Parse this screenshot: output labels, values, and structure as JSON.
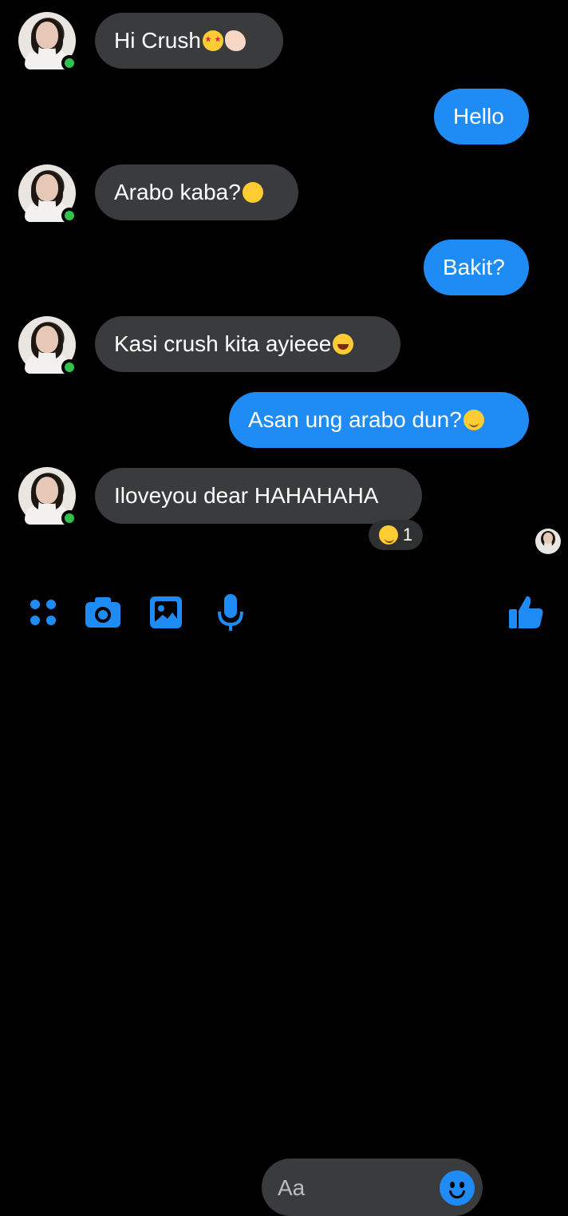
{
  "messages": [
    {
      "id": "m1",
      "side": "incoming",
      "text": "Hi Crush",
      "emoji": "heart-eyes-emoji,waving-hand-emoji"
    },
    {
      "id": "m2",
      "side": "outgoing",
      "text": "Hello"
    },
    {
      "id": "m3",
      "side": "incoming",
      "text": "Arabo kaba?",
      "emoji": "thinking-emoji"
    },
    {
      "id": "m4",
      "side": "outgoing",
      "text": "Bakit?"
    },
    {
      "id": "m5",
      "side": "incoming",
      "text": "Kasi crush kita ayieee",
      "emoji": "laughing-crying-emoji"
    },
    {
      "id": "m6",
      "side": "outgoing",
      "text": "Asan ung arabo dun?",
      "emoji": "relieved-emoji"
    },
    {
      "id": "m7",
      "side": "incoming",
      "text": "Iloveyou dear HAHAHAHA"
    }
  ],
  "reaction": {
    "emoji": "grinning-sweat-emoji",
    "count": "1"
  },
  "composer": {
    "placeholder": "Aa"
  },
  "colors": {
    "background": "#000000",
    "incoming_bubble": "#3a3b3c",
    "outgoing_bubble": "#1f8cf5",
    "accent": "#1f8cf5",
    "online": "#31c24d"
  },
  "icons": {
    "apps": "apps-icon",
    "camera": "camera-icon",
    "gallery": "image-gallery-icon",
    "microphone": "microphone-icon",
    "emoji": "smile-icon",
    "like": "thumbs-up-icon"
  }
}
